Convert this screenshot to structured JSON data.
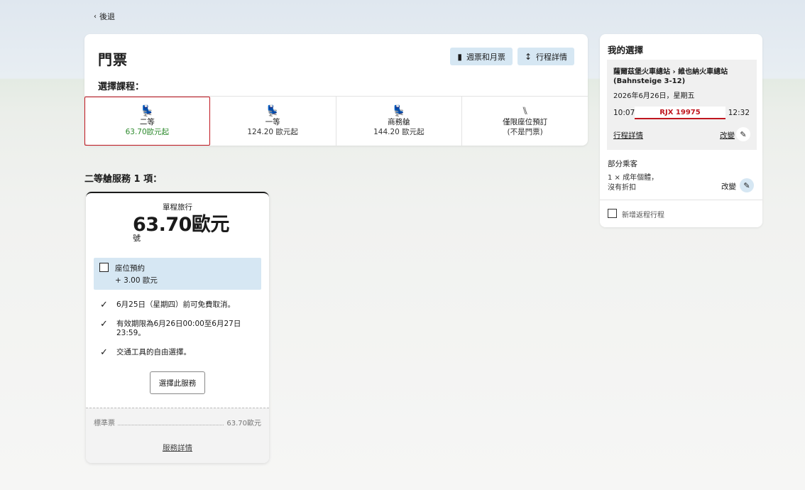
{
  "nav": {
    "back_label": "後退"
  },
  "ticket": {
    "title": "門票",
    "pass_button": "週票和月票",
    "details_button": "行程詳情",
    "choose_label": "選擇課程：",
    "classes": [
      {
        "name": "二等",
        "price": "63.70歐元起",
        "selected": true
      },
      {
        "name": "一等",
        "price": "124.20 歐元起",
        "selected": false
      },
      {
        "name": "商務艙",
        "price": "144.20 歐元起",
        "selected": false
      },
      {
        "name": "僅限座位預訂",
        "price": "(不是門票)",
        "selected": false
      }
    ]
  },
  "offers": {
    "heading": "二等艙服務 1 項：",
    "card": {
      "trip_type": "單程旅行",
      "price": "63.70歐元",
      "sub_label": "號",
      "seat_reservation_label": "座位預約",
      "seat_reservation_price": "+ 3.00 歐元",
      "features": [
        "6月25日（星期四）前可免費取消。",
        "有效期限為6月26日00:00至6月27日 23:59。",
        "交通工具的自由選擇。"
      ],
      "select_button": "選擇此服務",
      "fare_name": "標準票",
      "fare_price": "63.70歐元",
      "details_link": "服務詳情"
    }
  },
  "selection": {
    "title": "我的選擇",
    "route": "薩爾茲堡火車總站 › 維也納火車總站 (Bahnsteige 3-12)",
    "date": "2026年6月26日，星期五",
    "departure": "10:07",
    "arrival": "12:32",
    "train": "RJX 19975",
    "details_link": "行程詳情",
    "change_label": "改變",
    "passengers_title": "部分乘客",
    "passengers_line1": "1 × 成年個體，",
    "passengers_line2": "沒有折扣",
    "passengers_change": "改變",
    "return_label": "新增返程行程"
  },
  "colors": {
    "accent_red": "#c0161f",
    "light_blue": "#d6e7f3",
    "price_green": "#2d8a2d"
  }
}
